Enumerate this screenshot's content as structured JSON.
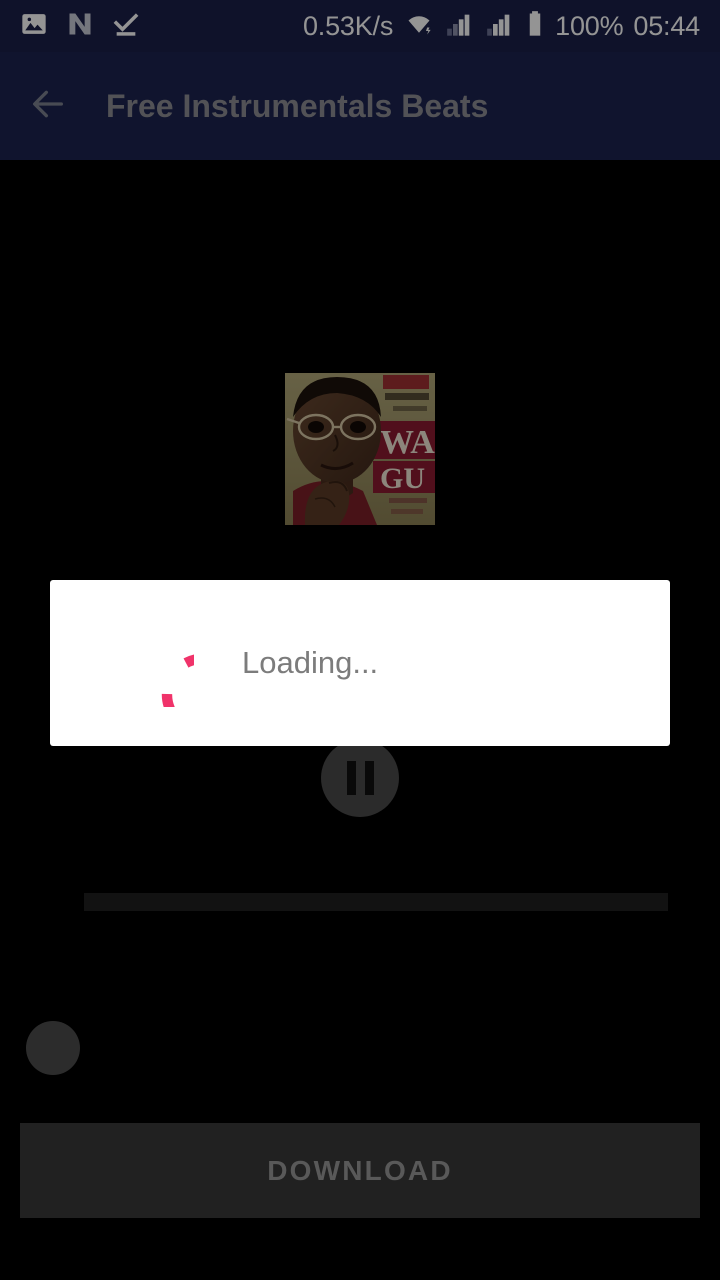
{
  "status_bar": {
    "background": "#1a2049",
    "left_icons": [
      {
        "name": "image-icon",
        "label": "image"
      },
      {
        "name": "nova-n-icon",
        "label": "N"
      },
      {
        "name": "check-download-icon",
        "label": "check"
      }
    ],
    "network_speed": "0.53K/s",
    "wifi_icon": "wifi-icon",
    "signal_icon_1": "signal-bars-icon",
    "signal_icon_2": "signal-bars-icon",
    "battery_icon": "battery-full-icon",
    "battery_percent": "100%",
    "clock": "05:44"
  },
  "app_bar": {
    "background": "#1c2350",
    "back_icon": "arrow-back-icon",
    "title": "Free Instrumentals Beats",
    "title_color": "#8d8d95"
  },
  "player": {
    "album_art_name": "album-art",
    "play_pause_state": "pause",
    "play_pause_icon": "pause-icon",
    "seek_value": 0,
    "seek_min": 0,
    "seek_max": 100,
    "download_label": "DOWNLOAD",
    "download_text_color": "#9a9a9a",
    "download_background": "#3a3a3a"
  },
  "dialog": {
    "visible": true,
    "background": "#ffffff",
    "spinner_icon": "loading-spinner-icon",
    "spinner_color": "#f0336a",
    "message": "Loading...",
    "message_color": "#7c7c7c"
  }
}
